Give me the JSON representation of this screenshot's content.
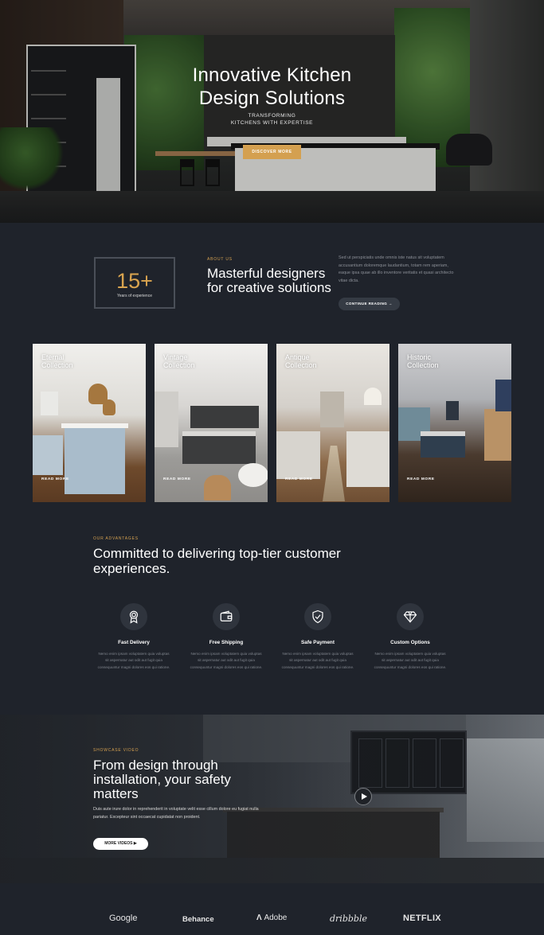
{
  "hero": {
    "title_line1": "Innovative Kitchen",
    "title_line2": "Design Solutions",
    "subtitle_line1": "TRANSFORMING",
    "subtitle_line2": "KITCHENS WITH EXPERTISE",
    "button_label": "DISCOVER MORE"
  },
  "about": {
    "years_number": "15+",
    "years_label": "Years of experience",
    "eyebrow": "ABOUT US",
    "title": "Masterful designers for creative solutions",
    "text": "Sed ut perspiciatis unde omnis iste natus sit voluptatem accusantium doloremque laudantium, totam rem aperiam, eaque ipsa quae ab illo inventore veritatis et quasi architecto vitae dicta.",
    "button_label": "CONTINUE READING →"
  },
  "collections": [
    {
      "title_line1": "Eternal",
      "title_line2": "Collection",
      "link": "READ MORE"
    },
    {
      "title_line1": "Vintage",
      "title_line2": "Collection",
      "link": "READ MORE"
    },
    {
      "title_line1": "Antique",
      "title_line2": "Collection",
      "link": "READ MORE"
    },
    {
      "title_line1": "Historic",
      "title_line2": "Collection",
      "link": "READ MORE"
    }
  ],
  "advantages": {
    "eyebrow": "OUR ADVANTAGES",
    "title": "Committed to delivering top-tier customer experiences.",
    "features": [
      {
        "icon": "award-icon",
        "title": "Fast Delivery",
        "text": "Nemo enim ipsam voluptatem quia voluptas sit aspernatur aut odit aut fugit quia consequuntur magni dolores eos qui ratione."
      },
      {
        "icon": "wallet-icon",
        "title": "Free Shipping",
        "text": "Nemo enim ipsam voluptatem quia voluptas sit aspernatur aut odit aut fugit quia consequuntur magni dolores eos qui ratione."
      },
      {
        "icon": "shield-check-icon",
        "title": "Safe Payment",
        "text": "Nemo enim ipsam voluptatem quia voluptas sit aspernatur aut odit aut fugit quia consequuntur magni dolores eos qui ratione."
      },
      {
        "icon": "diamond-icon",
        "title": "Custom Options",
        "text": "Nemo enim ipsam voluptatem quia voluptas sit aspernatur aut odit aut fugit quia consequuntur magni dolores eos qui ratione."
      }
    ]
  },
  "showcase": {
    "eyebrow": "SHOWCASE VIDEO",
    "title": "From design through installation, your safety matters",
    "text": "Duis aute irure dolor in reprehenderit in voluptate velit esse cillum dolore eu fugiat nulla pariatur. Excepteur sint occaecat cupidatat non proident.",
    "button_label": "MORE VIDEOS ▶"
  },
  "logos": [
    "Google",
    "Behance",
    "Adobe",
    "dribbble",
    "NETFLIX"
  ],
  "colors": {
    "background": "#1f232b",
    "accent": "#d4a050",
    "muted_text": "#8b8f97"
  }
}
